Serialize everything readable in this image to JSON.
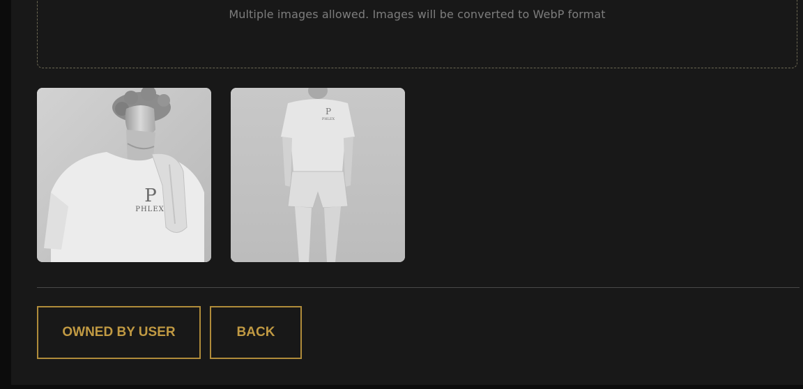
{
  "upload": {
    "hint": "Multiple images allowed. Images will be converted to WebP format"
  },
  "images": [
    {
      "alt": "Statue bust wearing white PHLEX t-shirt",
      "logo_text": "PHLEX"
    },
    {
      "alt": "Full-length statue wearing white PHLEX t-shirt and shorts",
      "logo_text": "PHLEX"
    }
  ],
  "actions": {
    "owned_label": "OWNED BY USER",
    "back_label": "BACK"
  },
  "colors": {
    "accent": "#b08c3a",
    "background": "#181818"
  }
}
